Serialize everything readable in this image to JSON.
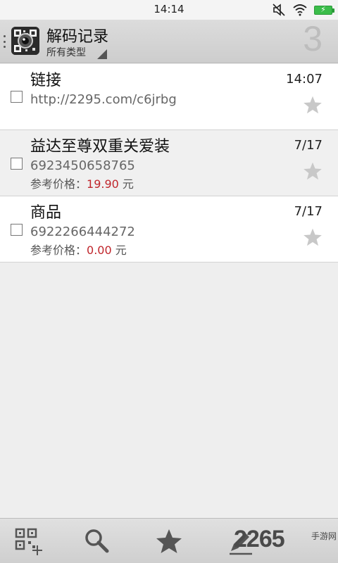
{
  "status_bar": {
    "time": "14:14",
    "battery_icon": "battery-charging-icon"
  },
  "header": {
    "title": "解码记录",
    "filter_label": "所有类型",
    "count": "3"
  },
  "records": [
    {
      "title": "链接",
      "subtitle": "http://2295.com/c6jrbg",
      "price_label": "",
      "price_value": "",
      "price_unit": "",
      "date": "14:07"
    },
    {
      "title": "益达至尊双重关爱装",
      "subtitle": "6923450658765",
      "price_label": "参考价格：",
      "price_value": "19.90",
      "price_unit": " 元",
      "date": "7/17"
    },
    {
      "title": "商品",
      "subtitle": "6922266444272",
      "price_label": "参考价格：",
      "price_value": "0.00",
      "price_unit": " 元",
      "date": "7/17"
    }
  ],
  "toolbar": {
    "icons": [
      "qr-add-icon",
      "search-icon",
      "star-icon",
      "edit-icon"
    ]
  },
  "watermark": {
    "text": "2265",
    "sub": "手游网"
  },
  "colors": {
    "price": "#c0262c",
    "star": "#c8c8c8"
  }
}
